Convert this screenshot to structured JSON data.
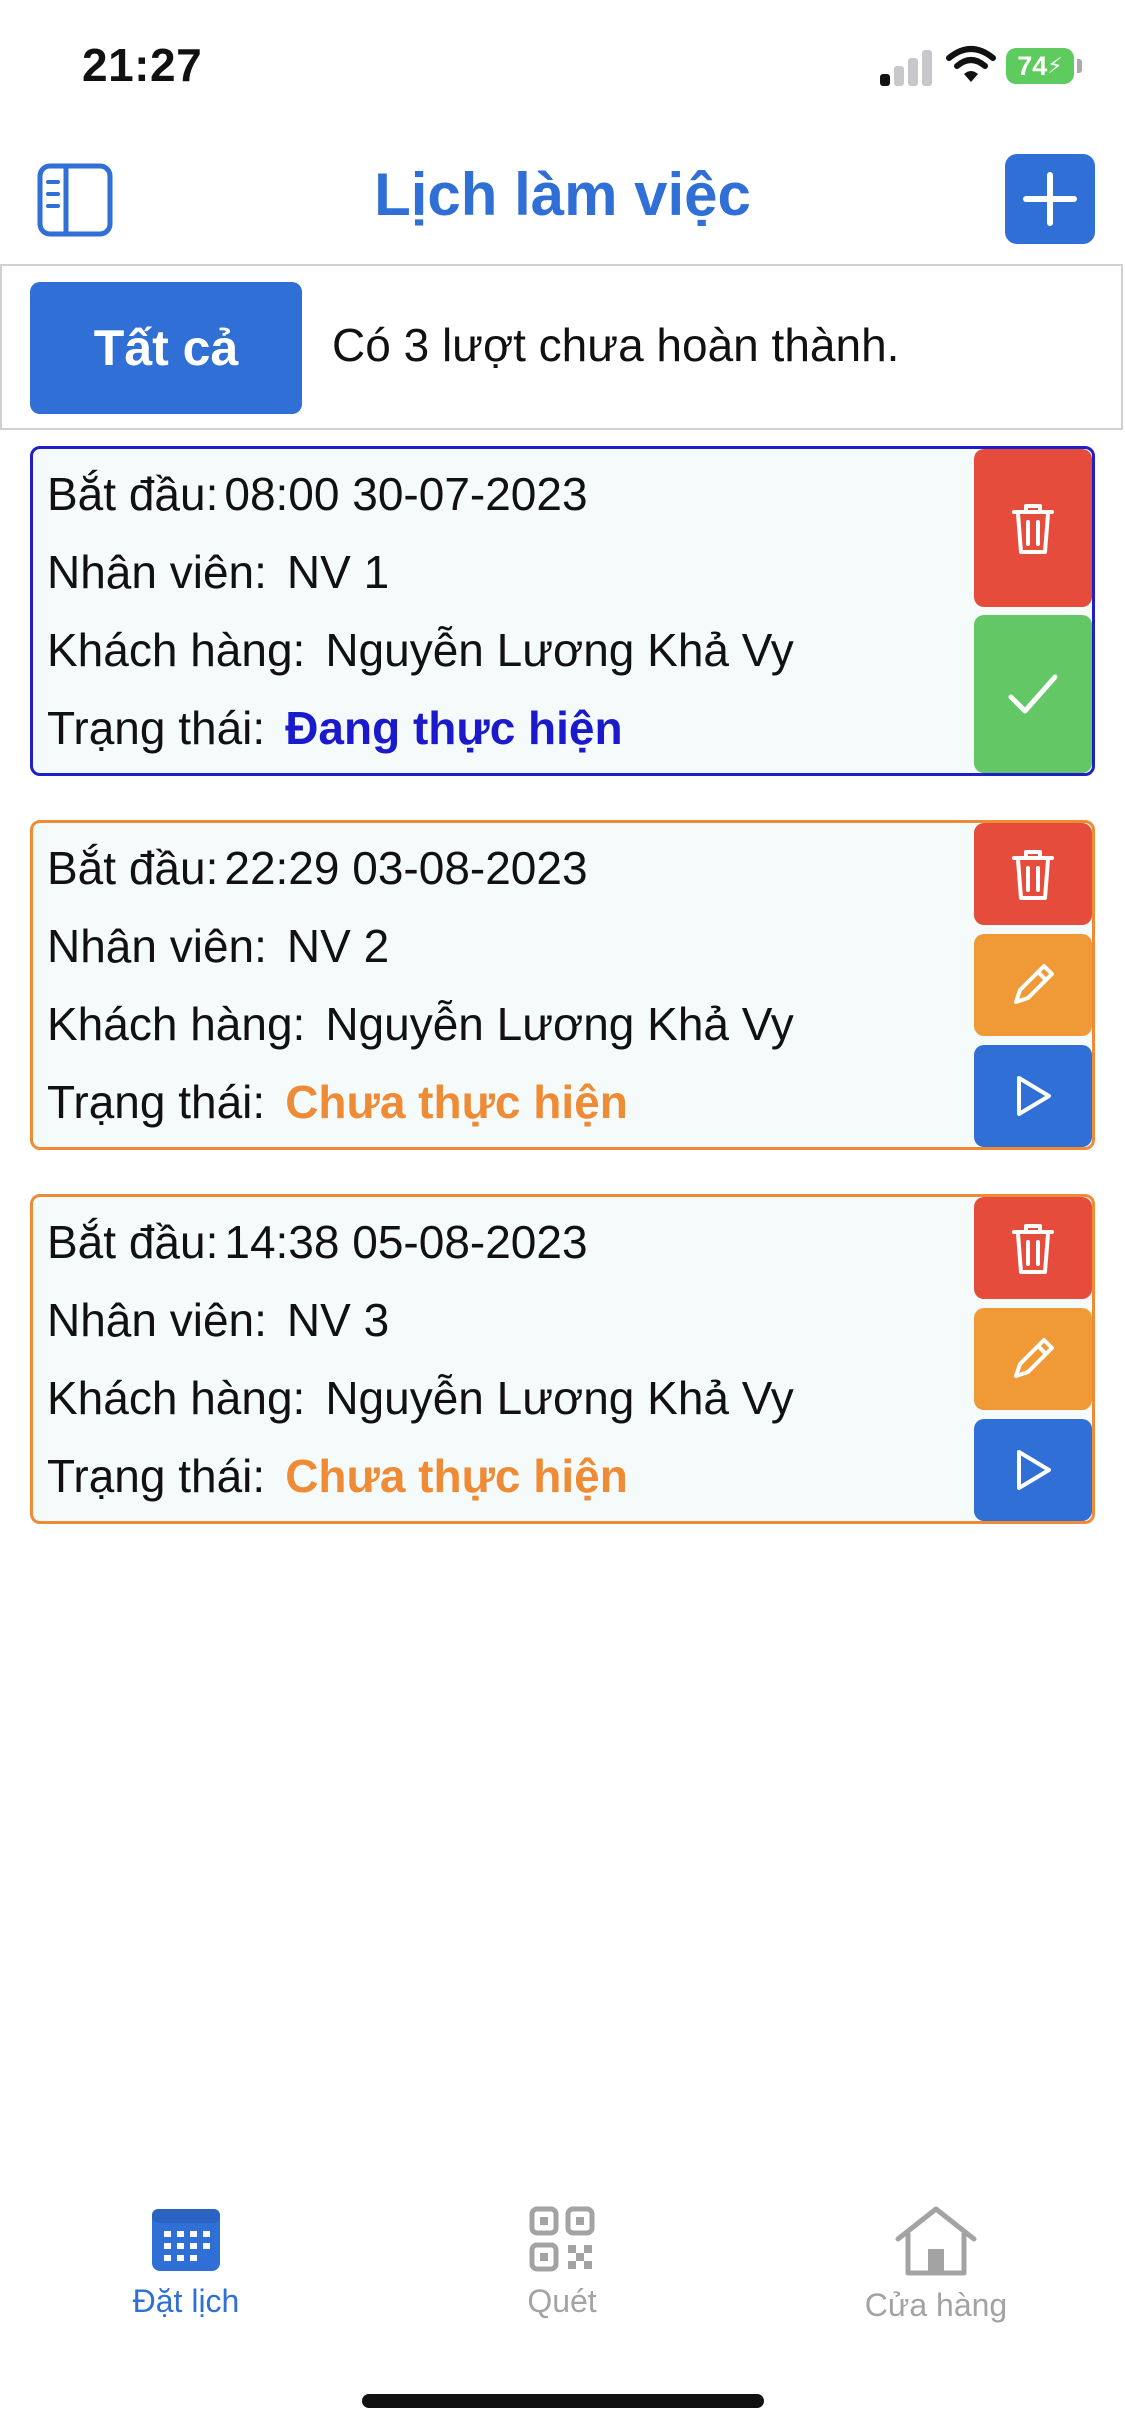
{
  "status_bar": {
    "time": "21:27",
    "battery": "74"
  },
  "header": {
    "title": "Lịch làm việc",
    "left_icon": "sidebar-icon",
    "right_icon": "plus-icon"
  },
  "filter": {
    "all_label": "Tất cả",
    "summary": "Có 3 lượt chưa hoàn thành."
  },
  "labels": {
    "start": "Bắt đầu:",
    "employee": "Nhân viên:",
    "customer": "Khách hàng:",
    "status": "Trạng thái:"
  },
  "schedules": [
    {
      "start": "08:00 30-07-2023",
      "employee": "NV 1",
      "customer": "Nguyễn Lương Khả Vy",
      "status": "Đang thực hiện",
      "status_color": "#1a1acc",
      "border_color": "#2020c8",
      "actions": [
        "trash-icon",
        "check-icon"
      ]
    },
    {
      "start": "22:29 03-08-2023",
      "employee": "NV 2",
      "customer": "Nguyễn Lương Khả Vy",
      "status": "Chưa thực hiện",
      "status_color": "#ef8a35",
      "border_color": "#ef8a35",
      "actions": [
        "trash-icon",
        "pencil-icon",
        "play-icon"
      ]
    },
    {
      "start": "14:38 05-08-2023",
      "employee": "NV 3",
      "customer": "Nguyễn Lương Khả Vy",
      "status": "Chưa thực hiện",
      "status_color": "#ef8a35",
      "border_color": "#ef8a35",
      "actions": [
        "trash-icon",
        "pencil-icon",
        "play-icon"
      ]
    }
  ],
  "tabbar": {
    "items": [
      {
        "label": "Đặt lịch",
        "icon": "calendar-icon",
        "active": true
      },
      {
        "label": "Quét",
        "icon": "qr-code-icon",
        "active": false
      },
      {
        "label": "Cửa hàng",
        "icon": "home-icon",
        "active": false
      }
    ]
  },
  "colors": {
    "primary": "#2f6fd6",
    "delete": "#e64c3c",
    "confirm": "#63c765",
    "edit": "#ef9a36",
    "card_bg": "#f5fbfb"
  }
}
